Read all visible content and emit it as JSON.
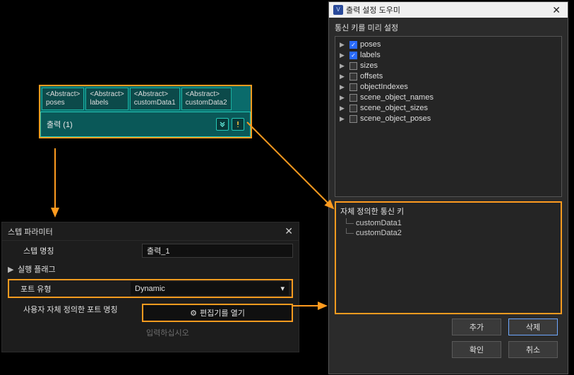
{
  "node": {
    "ports": [
      {
        "type": "<Abstract>",
        "name": "poses"
      },
      {
        "type": "<Abstract>",
        "name": "labels"
      },
      {
        "type": "<Abstract>",
        "name": "customData1"
      },
      {
        "type": "<Abstract>",
        "name": "customData2"
      }
    ],
    "title": "출력 (1)"
  },
  "step_panel": {
    "header": "스텝 파라미터",
    "rows": {
      "step_name_label": "스텝 명칭",
      "step_name_value": "출력_1",
      "exec_flag_label": "실행 플래그",
      "port_type_label": "포트 유형",
      "port_type_value": "Dynamic",
      "user_port_name_label": "사용자 자체 정의한 포트 명칭",
      "open_editor_btn": "편집기를 열기",
      "placeholder": "입력하십시오"
    }
  },
  "dialog": {
    "title": "출력 설정 도우미",
    "preset_label": "통신 키를 미리 설정",
    "preset_items": [
      {
        "label": "poses",
        "checked": true
      },
      {
        "label": "labels",
        "checked": true
      },
      {
        "label": "sizes",
        "checked": false
      },
      {
        "label": "offsets",
        "checked": false
      },
      {
        "label": "objectIndexes",
        "checked": false
      },
      {
        "label": "scene_object_names",
        "checked": false
      },
      {
        "label": "scene_object_sizes",
        "checked": false
      },
      {
        "label": "scene_object_poses",
        "checked": false
      }
    ],
    "custom_label": "자체 정의한 통신 키",
    "custom_items": [
      "customData1",
      "customData2"
    ],
    "buttons": {
      "add": "추가",
      "delete": "삭제",
      "ok": "확인",
      "cancel": "취소"
    }
  }
}
